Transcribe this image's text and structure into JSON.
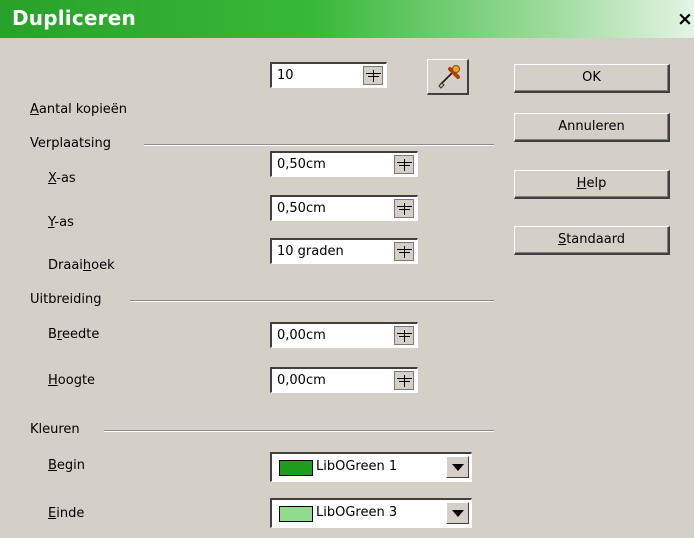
{
  "window": {
    "title": "Dupliceren",
    "close_glyph": "×"
  },
  "copies": {
    "label_pre": "",
    "label_mn": "A",
    "label_post": "antal kopieën",
    "value": "10"
  },
  "placement": {
    "heading": "Verplaatsing",
    "x_axis": {
      "label_pre": "",
      "label_mn": "X",
      "label_post": "-as",
      "value": "0,50cm"
    },
    "y_axis": {
      "label_pre": "",
      "label_mn": "Y",
      "label_post": "-as",
      "value": "0,50cm"
    },
    "angle": {
      "label_pre": "Draai",
      "label_mn": "h",
      "label_post": "oek",
      "value": "10 graden"
    }
  },
  "enlargement": {
    "heading": "Uitbreiding",
    "width": {
      "label_pre": "B",
      "label_mn": "r",
      "label_post": "eedte",
      "value": "0,00cm"
    },
    "height": {
      "label_pre": "",
      "label_mn": "H",
      "label_post": "oogte",
      "value": "0,00cm"
    }
  },
  "colors": {
    "heading": "Kleuren",
    "start": {
      "label_pre": "",
      "label_mn": "B",
      "label_post": "egin",
      "value": "LibOGreen 1",
      "swatch": "#1e9c1e"
    },
    "end": {
      "label_pre": "",
      "label_mn": "E",
      "label_post": "inde",
      "value": "LibOGreen 3",
      "swatch": "#8fdc8f"
    }
  },
  "buttons": {
    "ok": "OK",
    "cancel": "Annuleren",
    "help_pre": "",
    "help_mn": "H",
    "help_post": "elp",
    "default_pre": "",
    "default_mn": "S",
    "default_post": "tandaard"
  },
  "icons": {
    "values_from_selection": "eyedropper-icon",
    "spin": "spin-button-icon",
    "dropdown": "dropdown-arrow-icon"
  }
}
